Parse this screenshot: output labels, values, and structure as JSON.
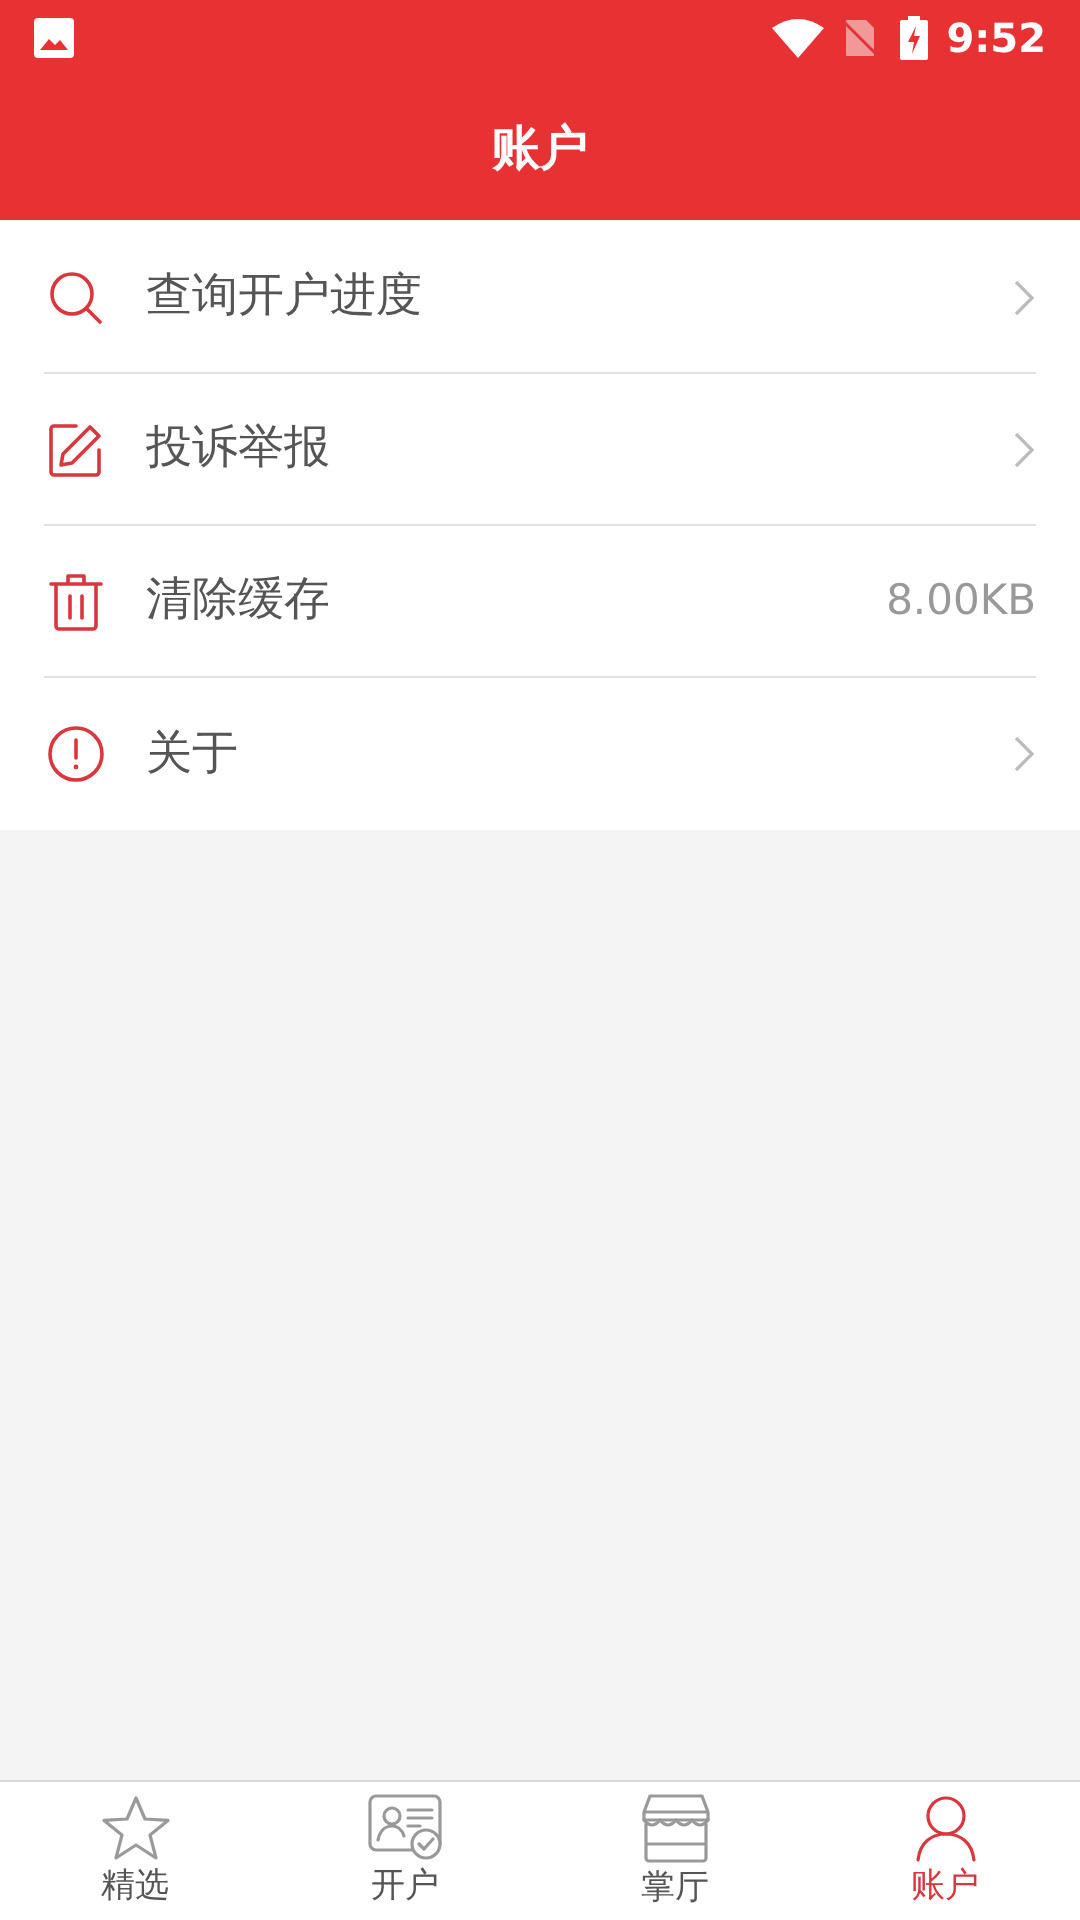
{
  "status_bar": {
    "time": "9:52"
  },
  "header": {
    "title": "账户"
  },
  "menu": [
    {
      "label": "查询开户进度",
      "kind": "link"
    },
    {
      "label": "投诉举报",
      "kind": "link"
    },
    {
      "label": "清除缓存",
      "kind": "value",
      "value": "8.00KB"
    },
    {
      "label": "关于",
      "kind": "link"
    }
  ],
  "bottom_nav": [
    {
      "label": "精选",
      "selected": false
    },
    {
      "label": "开户",
      "selected": false
    },
    {
      "label": "掌厅",
      "selected": false
    },
    {
      "label": "账户",
      "selected": true
    }
  ]
}
